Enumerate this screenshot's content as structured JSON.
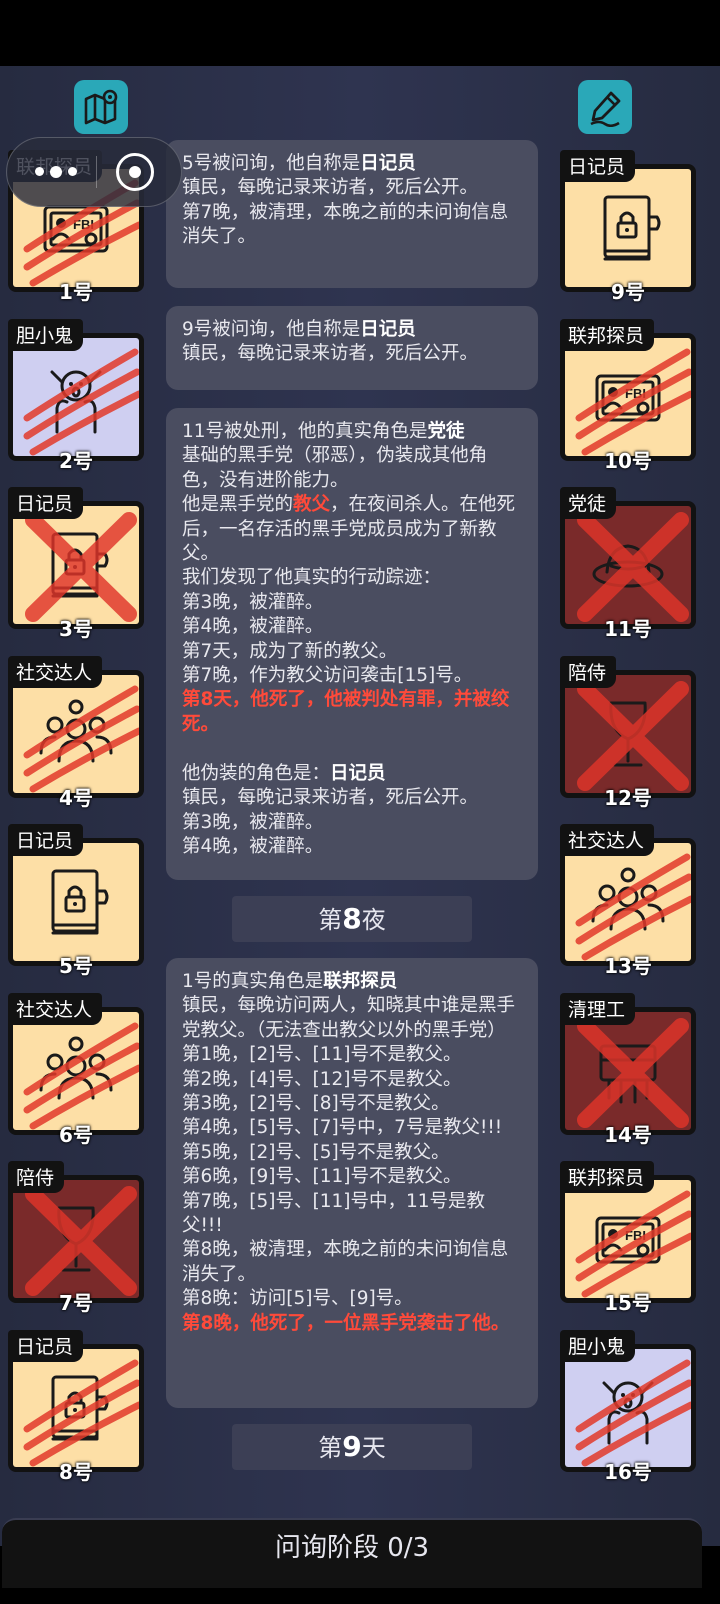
{
  "players": [
    {
      "num": "1号",
      "role": "联邦探员",
      "bg": "beige",
      "icon": "fbi-badge-icon",
      "mark": "scratch"
    },
    {
      "num": "2号",
      "role": "胆小鬼",
      "bg": "lav",
      "icon": "scared-face-icon",
      "mark": "scratch"
    },
    {
      "num": "3号",
      "role": "日记员",
      "bg": "beige",
      "icon": "locked-diary-icon",
      "mark": "cross"
    },
    {
      "num": "4号",
      "role": "社交达人",
      "bg": "beige",
      "icon": "crowd-icon",
      "mark": "scratch"
    },
    {
      "num": "5号",
      "role": "日记员",
      "bg": "beige",
      "icon": "locked-diary-icon",
      "mark": "none"
    },
    {
      "num": "6号",
      "role": "社交达人",
      "bg": "beige",
      "icon": "crowd-icon",
      "mark": "scratch"
    },
    {
      "num": "7号",
      "role": "陪侍",
      "bg": "dark",
      "icon": "wine-glass-icon",
      "mark": "cross"
    },
    {
      "num": "8号",
      "role": "日记员",
      "bg": "beige",
      "icon": "locked-diary-icon",
      "mark": "scratch"
    },
    {
      "num": "9号",
      "role": "日记员",
      "bg": "beige",
      "icon": "locked-diary-icon",
      "mark": "none"
    },
    {
      "num": "10号",
      "role": "联邦探员",
      "bg": "beige",
      "icon": "fbi-badge-icon",
      "mark": "scratch"
    },
    {
      "num": "11号",
      "role": "党徒",
      "bg": "dark",
      "icon": "fedora-hat-icon",
      "mark": "cross"
    },
    {
      "num": "12号",
      "role": "陪侍",
      "bg": "dark",
      "icon": "wine-glass-icon",
      "mark": "cross"
    },
    {
      "num": "13号",
      "role": "社交达人",
      "bg": "beige",
      "icon": "crowd-icon",
      "mark": "scratch"
    },
    {
      "num": "14号",
      "role": "清理工",
      "bg": "dark",
      "icon": "cleaner-icon",
      "mark": "cross"
    },
    {
      "num": "15号",
      "role": "联邦探员",
      "bg": "beige",
      "icon": "fbi-badge-icon",
      "mark": "scratch"
    },
    {
      "num": "16号",
      "role": "胆小鬼",
      "bg": "lav",
      "icon": "scared-face-icon",
      "mark": "scratch"
    }
  ],
  "messages": [
    {
      "lines": [
        {
          "t": "5号被问询，他自称是"
        },
        {
          "t": "日记员",
          "s": "b"
        },
        {
          "t": "\n镇民，每晚记录来访者，死后公开。\n第7晚，被清理，本晚之前的未问询信息消失了。"
        }
      ]
    },
    {
      "lines": [
        {
          "t": "9号被问询，他自称是"
        },
        {
          "t": "日记员",
          "s": "b"
        },
        {
          "t": "\n镇民，每晚记录来访者，死后公开。"
        }
      ]
    },
    {
      "lines": [
        {
          "t": "11号被处刑，他的真实角色是"
        },
        {
          "t": "党徒",
          "s": "b"
        },
        {
          "t": "\n基础的黑手党（邪恶），伪装成其他角色，没有进阶能力。\n他是黑手党的"
        },
        {
          "t": "教父",
          "s": "red"
        },
        {
          "t": "，在夜间杀人。在他死后，一名存活的黑手党成员成为了新教父。\n我们发现了他真实的行动踪迹：\n第3晚，被灌醉。\n第4晚，被灌醉。\n第7天，成为了新的教父。\n第7晚，作为教父访问袭击[15]号。\n"
        },
        {
          "t": "第8天，他死了，他被判处有罪，并被绞死。",
          "s": "red"
        },
        {
          "t": "\n\n他伪装的角色是："
        },
        {
          "t": "日记员",
          "s": "b"
        },
        {
          "t": "\n镇民，每晚记录来访者，死后公开。\n第3晚，被灌醉。\n第4晚，被灌醉。"
        }
      ]
    },
    {
      "lines": [
        {
          "t": "1号的真实角色是"
        },
        {
          "t": "联邦探员",
          "s": "b"
        },
        {
          "t": "\n镇民，每晚访问两人，知晓其中谁是黑手党教父。（无法查出教父以外的黑手党）\n第1晚，[2]号、[11]号不是教父。\n第2晚，[4]号、[12]号不是教父。\n第3晚，[2]号、[8]号不是教父。\n第4晚，[5]号、[7]号中，7号是教父!!!\n第5晚，[2]号、[5]号不是教父。\n第6晚，[9]号、[11]号不是教父。\n第7晚，[5]号、[11]号中，11号是教父!!!\n第8晚，被清理，本晚之前的未问询信息消失了。\n第8晚：访问[5]号、[9]号。\n"
        },
        {
          "t": "第8晚，他死了，一位黑手党袭击了他。",
          "s": "red"
        }
      ]
    }
  ],
  "phase_night": {
    "prefix": "第",
    "num": "8",
    "suffix": "夜"
  },
  "phase_day": {
    "prefix": "第",
    "num": "9",
    "suffix": "天"
  },
  "bottom": {
    "label": "问询阶段 0/3"
  },
  "colors": {
    "scratch": "#e23a2a",
    "cross": "#e0352a",
    "teal": "#2aa8b8"
  }
}
